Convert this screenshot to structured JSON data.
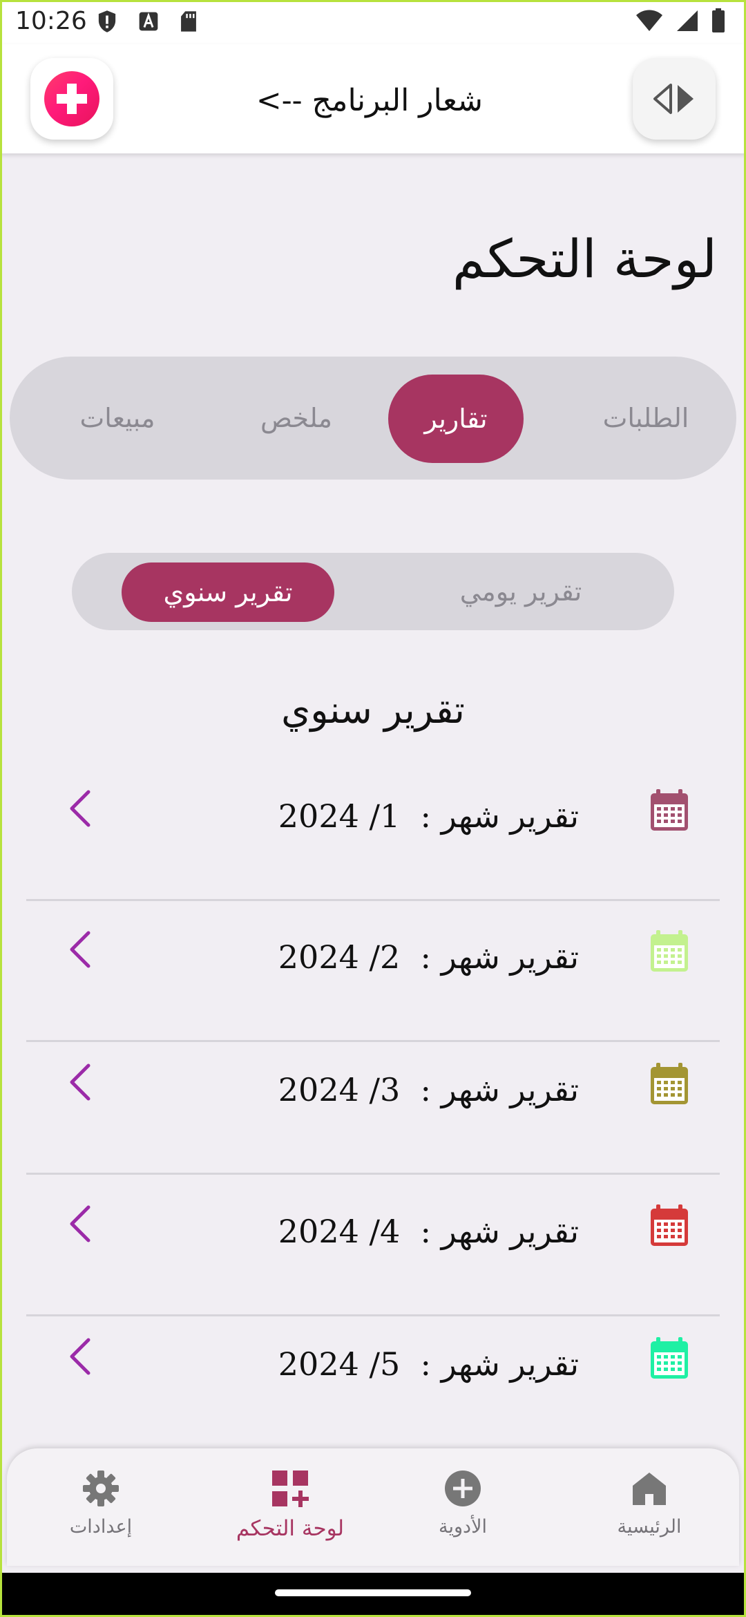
{
  "status_bar": {
    "time": "10:26",
    "icons": [
      "shield-icon",
      "font-icon",
      "sd-card-icon",
      "wifi-icon",
      "signal-icon",
      "battery-icon"
    ]
  },
  "header": {
    "title": "شعار البرنامج -->",
    "logo_icon": "medical-cross-icon",
    "toggle_icon": "code-arrows-icon"
  },
  "page_title": "لوحة التحكم",
  "main_tabs": [
    "الطلبات",
    "تقارير",
    "ملخص",
    "مبيعات"
  ],
  "main_tabs_active": "تقارير",
  "sub_tabs": [
    "تقرير يومي",
    "تقرير سنوي"
  ],
  "sub_tabs_active": "تقرير سنوي",
  "section_title": "تقرير سنوي",
  "reports": [
    {
      "label": "تقرير شهر :",
      "value": "2024 /1",
      "icon_color": "#a2506f"
    },
    {
      "label": "تقرير شهر :",
      "value": "2024 /2",
      "icon_color": "#c3f18f"
    },
    {
      "label": "تقرير شهر :",
      "value": "2024 /3",
      "icon_color": "#a39533"
    },
    {
      "label": "تقرير شهر :",
      "value": "2024 /4",
      "icon_color": "#d53a3a"
    },
    {
      "label": "تقرير شهر :",
      "value": "2024 /5",
      "icon_color": "#1ff0a4"
    }
  ],
  "bottom_nav": [
    {
      "label": "الرئيسية",
      "icon": "home-icon"
    },
    {
      "label": "الأدوية",
      "icon": "add-circle-icon"
    },
    {
      "label": "لوحة التحكم",
      "icon": "dashboard-add-icon"
    },
    {
      "label": "إعدادات",
      "icon": "gear-icon"
    }
  ],
  "bottom_nav_active": "لوحة التحكم",
  "colors": {
    "accent": "#a73561",
    "chevron": "#9b2aa8",
    "tab_bg": "#d8d6dc",
    "page_bg": "#f1eef3"
  }
}
